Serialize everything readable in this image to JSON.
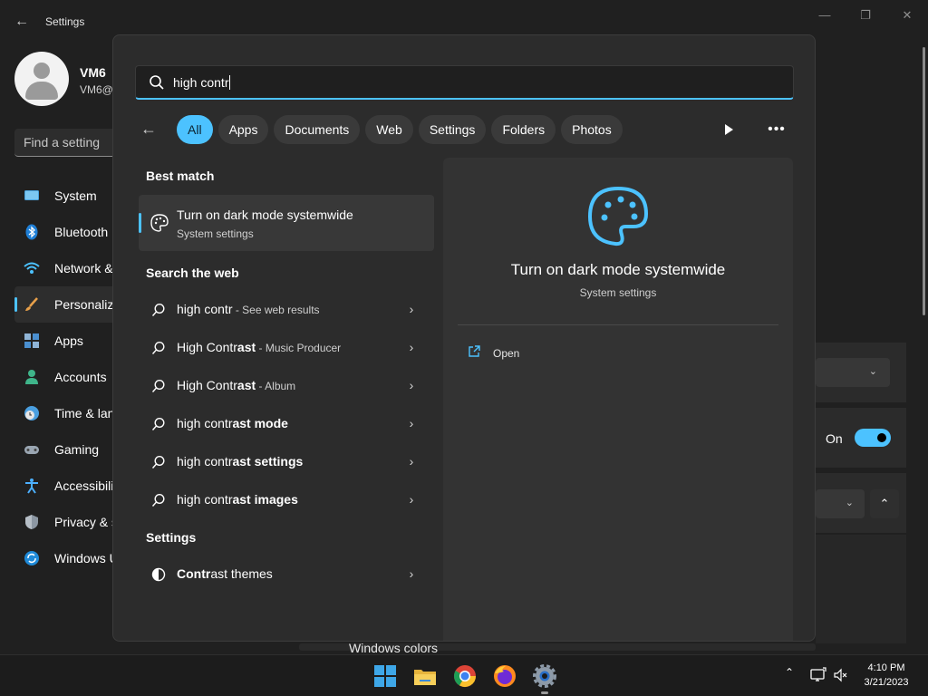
{
  "settings": {
    "title": "Settings",
    "window_controls": {
      "minimize": "—",
      "maximize": "❐",
      "close": "✕"
    },
    "profile": {
      "name": "VM6",
      "email": "VM6@"
    },
    "find_placeholder": "Find a setting",
    "nav": [
      {
        "label": "System",
        "icon": "system-icon"
      },
      {
        "label": "Bluetooth",
        "icon": "bluetooth-icon"
      },
      {
        "label": "Network &",
        "icon": "network-icon"
      },
      {
        "label": "Personaliz",
        "icon": "personalization-icon"
      },
      {
        "label": "Apps",
        "icon": "apps-icon"
      },
      {
        "label": "Accounts",
        "icon": "accounts-icon"
      },
      {
        "label": "Time & lan",
        "icon": "time-language-icon"
      },
      {
        "label": "Gaming",
        "icon": "gaming-icon"
      },
      {
        "label": "Accessibilit",
        "icon": "accessibility-icon"
      },
      {
        "label": "Privacy & s",
        "icon": "privacy-icon"
      },
      {
        "label": "Windows U",
        "icon": "windows-update-icon"
      }
    ],
    "toggle_label": "On",
    "toggle_state": true,
    "windows_colors": "Windows colors"
  },
  "search": {
    "query": "high contr",
    "back_label": "←",
    "filters": [
      "All",
      "Apps",
      "Documents",
      "Web",
      "Settings",
      "Folders",
      "Photos"
    ],
    "active_filter": "All",
    "more_label": "•••",
    "best_match_heading": "Best match",
    "best_match": {
      "title": "Turn on dark mode systemwide",
      "subtitle": "System settings"
    },
    "web_heading": "Search the web",
    "web_results": [
      {
        "pre": "high contr",
        "bold": "",
        "suffix": " - See web results"
      },
      {
        "pre": "High Contr",
        "bold": "ast",
        "suffix": " - Music Producer"
      },
      {
        "pre": "High Contr",
        "bold": "ast",
        "suffix": " - Album"
      },
      {
        "pre": "high contr",
        "bold": "ast mode",
        "suffix": ""
      },
      {
        "pre": "high contr",
        "bold": "ast settings",
        "suffix": ""
      },
      {
        "pre": "high contr",
        "bold": "ast images",
        "suffix": ""
      }
    ],
    "settings_heading": "Settings",
    "settings_results": [
      {
        "bold_pre": "Contr",
        "post": "ast themes",
        "icon": "contrast-icon"
      }
    ],
    "preview": {
      "title": "Turn on dark mode systemwide",
      "subtitle": "System settings",
      "action": "Open"
    }
  },
  "taskbar": {
    "apps": [
      "start-icon",
      "file-explorer-icon",
      "chrome-icon",
      "firefox-icon",
      "settings-app-icon"
    ],
    "clock_time": "4:10 PM",
    "clock_date": "3/21/2023",
    "accent": "#4cc2ff"
  }
}
